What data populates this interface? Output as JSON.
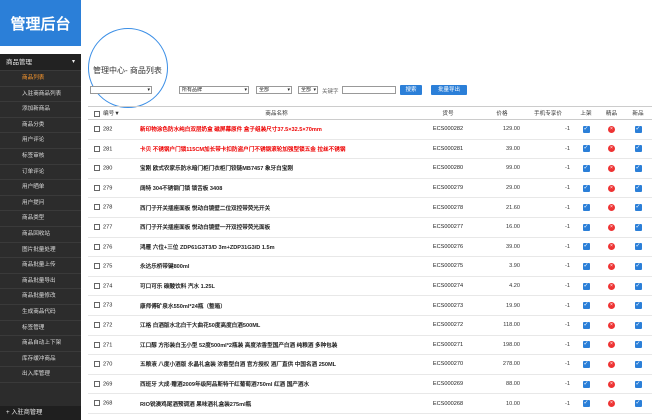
{
  "header": {
    "title": "管理后台"
  },
  "sidebar": {
    "section": "商品管理",
    "items": [
      "商品列表",
      "入驻商商品列表",
      "添加新商品",
      "商品分类",
      "用户评论",
      "标签审核",
      "订单评论",
      "用户晒单",
      "用户提问",
      "商品类型",
      "商品回收站",
      "图片批量处理",
      "商品批量上传",
      "商品批量导出",
      "商品批量修改",
      "生成商品代码",
      "标签管理",
      "商品自动上下架",
      "库存缓冲商品",
      "出入库管理"
    ],
    "footer": "入驻商管理"
  },
  "main": {
    "breadcrumb": "管理中心- 商品列表",
    "filters": {
      "category": "",
      "brand": "所有品牌",
      "type": "全部",
      "type2": "全部",
      "keyword_label": "关键字",
      "search_btn": "搜索",
      "export_btn": "批量导出"
    },
    "table": {
      "headers": [
        "编号",
        "商品名称",
        "货号",
        "价格",
        "手机专享价",
        "上架",
        "精品",
        "新品"
      ],
      "rows": [
        {
          "id": "282",
          "name": "新印物涂色防水纯白双层奶盒 磁屏幕原件 盒子组装尺寸37.5×32.5×70mm",
          "sku": "ECS000282",
          "price": "129.00",
          "mobile": "-1",
          "on": true,
          "best": false,
          "new": true,
          "red": true
        },
        {
          "id": "281",
          "name": "卡贝 不锈钢户门锁115CM加长带卡扣防盗户门不锈钢滚轮加强型锁五金 拉丝不锈钢",
          "sku": "ECS000281",
          "price": "39.00",
          "mobile": "-1",
          "on": true,
          "best": false,
          "new": true,
          "red": true
        },
        {
          "id": "280",
          "name": "宝刚 欧式农家乐防水暗门柜门衣柜门铰链MB7457 象牙白宝刚",
          "sku": "ECS000280",
          "price": "99.00",
          "mobile": "-1",
          "on": true,
          "best": false,
          "new": true,
          "red": false
        },
        {
          "id": "279",
          "name": "阔特 304不锈钢门锁 锁舌板 3408",
          "sku": "ECS000279",
          "price": "29.00",
          "mobile": "-1",
          "on": true,
          "best": false,
          "new": true,
          "red": false
        },
        {
          "id": "278",
          "name": "西门子开关插座面板 悦动白镜壁二位双控带荧光开关",
          "sku": "ECS000278",
          "price": "21.60",
          "mobile": "-1",
          "on": true,
          "best": false,
          "new": true,
          "red": false
        },
        {
          "id": "277",
          "name": "西门子开关插座面板 悦动白镜壁一开双控带荧光面板",
          "sku": "ECS000277",
          "price": "16.00",
          "mobile": "-1",
          "on": true,
          "best": false,
          "new": true,
          "red": false
        },
        {
          "id": "276",
          "name": "鸿雁 六位+三位 ZDP61G3T3/D 3m+ZDP31G3/D 1.5m",
          "sku": "ECS000276",
          "price": "39.00",
          "mobile": "-1",
          "on": true,
          "best": false,
          "new": true,
          "red": false
        },
        {
          "id": "275",
          "name": "永达乐桥带键800ml",
          "sku": "ECS000275",
          "price": "3.90",
          "mobile": "-1",
          "on": true,
          "best": false,
          "new": true,
          "red": false
        },
        {
          "id": "274",
          "name": "可口可乐 碳酸饮料 汽水 1.25L",
          "sku": "ECS000274",
          "price": "4.20",
          "mobile": "-1",
          "on": true,
          "best": false,
          "new": true,
          "red": false
        },
        {
          "id": "273",
          "name": "康师傅矿泉水550ml*24瓶（整箱）",
          "sku": "ECS000273",
          "price": "19.90",
          "mobile": "-1",
          "on": true,
          "best": false,
          "new": true,
          "red": false
        },
        {
          "id": "272",
          "name": "江格 白酒版水北白干大曲花50度高度白酒500ML",
          "sku": "ECS000272",
          "price": "118.00",
          "mobile": "-1",
          "on": true,
          "best": false,
          "new": true,
          "red": false
        },
        {
          "id": "271",
          "name": "江口醇 方形装白玉小型 52度500ml*2瓶装 高度浓香型国产白酒 纯粮酒 多种包装",
          "sku": "ECS000271",
          "price": "198.00",
          "mobile": "-1",
          "on": true,
          "best": false,
          "new": true,
          "red": false
        },
        {
          "id": "270",
          "name": "五粮液 八度小酒版 永晶礼盒装 浓香型白酒 官方授权 酒厂直供 中国名酒 250ML",
          "sku": "ECS000270",
          "price": "278.00",
          "mobile": "-1",
          "on": true,
          "best": false,
          "new": true,
          "red": false
        },
        {
          "id": "269",
          "name": "西班牙 大成·赠酒2009年级阿品斯特干红葡萄酒750ml 红酒 国产酒水",
          "sku": "ECS000269",
          "price": "88.00",
          "mobile": "-1",
          "on": true,
          "best": false,
          "new": true,
          "red": false
        },
        {
          "id": "268",
          "name": "RIO锐澳鸡尾酒预调酒 果味酒礼盒装275ml瓶",
          "sku": "ECS000268",
          "price": "10.00",
          "mobile": "-1",
          "on": true,
          "best": false,
          "new": true,
          "red": false
        }
      ]
    }
  },
  "colors": {
    "accent": "#2b7fd8",
    "sidebar": "#2c2c2c",
    "active": "#ff9a2e",
    "danger": "#e33"
  }
}
